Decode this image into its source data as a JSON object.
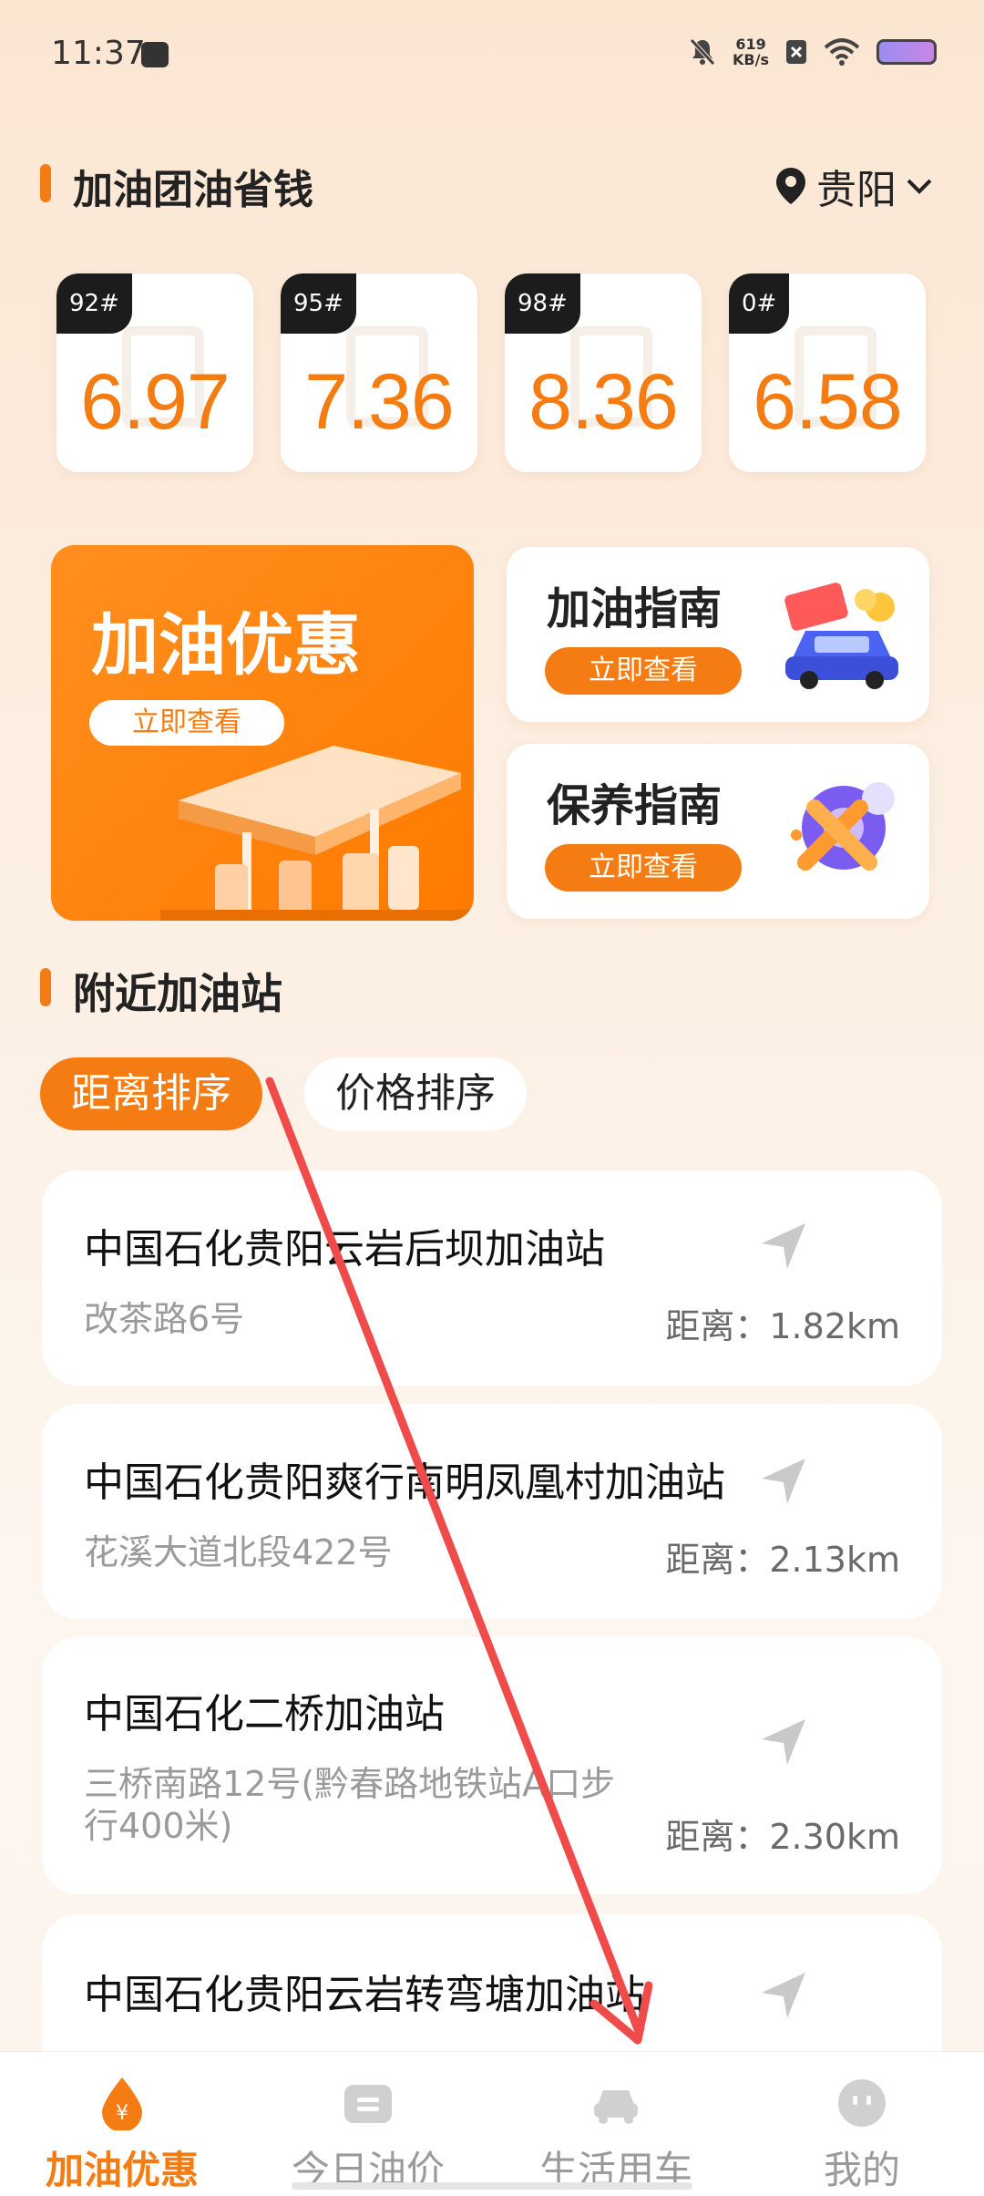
{
  "status": {
    "time": "11:37",
    "speed_value": "619",
    "speed_unit": "KB/s"
  },
  "header": {
    "title": "加油团油省钱",
    "city": "贵阳"
  },
  "prices": [
    {
      "grade": "92#",
      "price": "6.97"
    },
    {
      "grade": "95#",
      "price": "7.36"
    },
    {
      "grade": "98#",
      "price": "8.36"
    },
    {
      "grade": "0#",
      "price": "6.58"
    }
  ],
  "promo": {
    "main": {
      "title": "加油优惠",
      "button": "立即查看"
    },
    "guide": {
      "title": "加油指南",
      "button": "立即查看"
    },
    "maintenance": {
      "title": "保养指南",
      "button": "立即查看"
    }
  },
  "nearby": {
    "title": "附近加油站",
    "sort_distance": "距离排序",
    "sort_price": "价格排序",
    "stations": [
      {
        "name": "中国石化贵阳云岩后坝加油站",
        "address": "改茶路6号",
        "distance": "距离：1.82km"
      },
      {
        "name": "中国石化贵阳爽行南明凤凰村加油站",
        "address": "花溪大道北段422号",
        "distance": "距离：2.13km"
      },
      {
        "name": "中国石化二桥加油站",
        "address": "三桥南路12号(黔春路地铁站A口步行400米)",
        "distance": "距离：2.30km"
      },
      {
        "name": "中国石化贵阳云岩转弯塘加油站",
        "address": "",
        "distance": ""
      }
    ]
  },
  "tabs": [
    {
      "label": "加油优惠",
      "icon": "fuel-drop-yuan-icon",
      "active": true
    },
    {
      "label": "今日油价",
      "icon": "ticket-icon",
      "active": false
    },
    {
      "label": "生活用车",
      "icon": "car-icon",
      "active": false
    },
    {
      "label": "我的",
      "icon": "profile-face-icon",
      "active": false
    }
  ],
  "colors": {
    "accent": "#f57c12",
    "annotation_arrow": "#ef4b4b"
  }
}
